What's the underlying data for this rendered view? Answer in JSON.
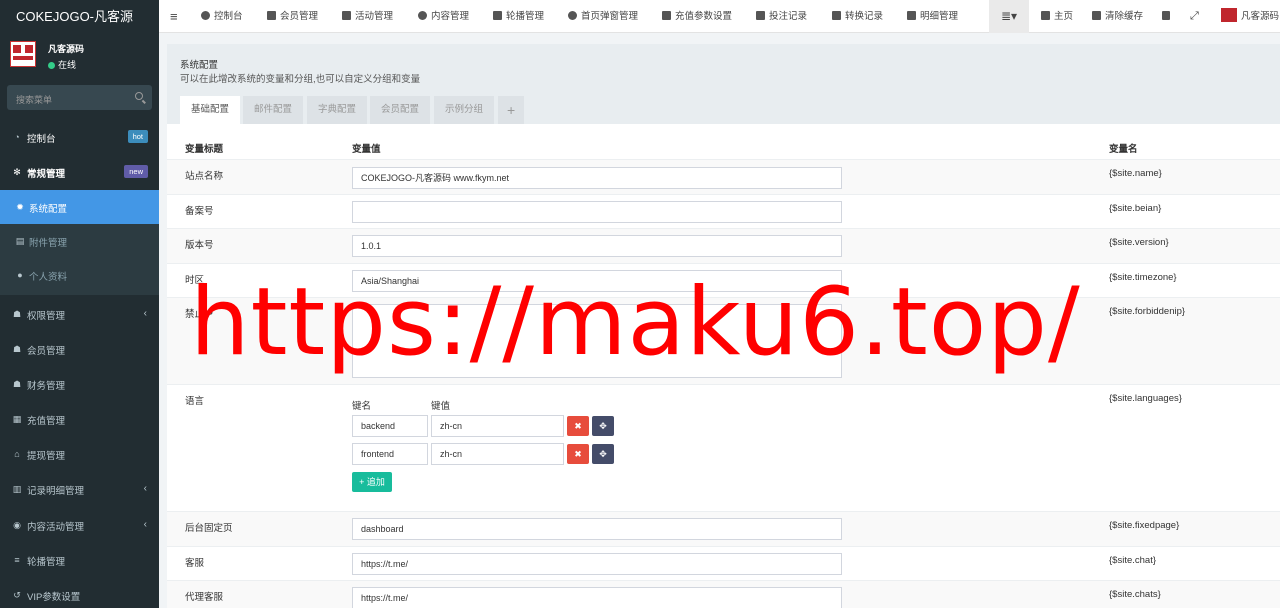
{
  "brand": {
    "title": "COKEJOGO-凡客源"
  },
  "user": {
    "name": "凡客源码",
    "status": "在线"
  },
  "search": {
    "placeholder": "搜索菜单"
  },
  "sidebar": {
    "items": [
      {
        "label": "控制台",
        "badge": "hot",
        "icon": "dashboard-icon"
      },
      {
        "label": "常规管理",
        "badge": "new",
        "icon": "cogs-icon"
      },
      {
        "label": "系统配置",
        "icon": "gear-icon"
      },
      {
        "label": "附件管理",
        "icon": "file-image-icon"
      },
      {
        "label": "个人资料",
        "icon": "user-icon"
      },
      {
        "label": "权限管理",
        "icon": "group-icon"
      },
      {
        "label": "会员管理",
        "icon": "users-icon"
      },
      {
        "label": "财务管理",
        "icon": "users-icon"
      },
      {
        "label": "充值管理",
        "icon": "th-large-icon"
      },
      {
        "label": "提现管理",
        "icon": "bank-icon"
      },
      {
        "label": "记录明细管理",
        "icon": "bar-chart-icon"
      },
      {
        "label": "内容活动管理",
        "icon": "chrome-icon"
      },
      {
        "label": "轮播管理",
        "icon": "list-icon"
      },
      {
        "label": "VIP参数设置",
        "icon": "history-icon"
      }
    ]
  },
  "topbar": {
    "tabs": [
      "控制台",
      "会员管理",
      "活动管理",
      "内容管理",
      "轮播管理",
      "首页弹窗管理",
      "充值参数设置",
      "投注记录",
      "转换记录",
      "明细管理"
    ],
    "home": "主页",
    "clear_cache": "清除缓存",
    "user": "凡客源码"
  },
  "panel": {
    "title": "系统配置",
    "description": "可以在此增改系统的变量和分组,也可以自定义分组和变量",
    "tabs": [
      "基础配置",
      "邮件配置",
      "字典配置",
      "会员配置",
      "示例分组"
    ],
    "add_tab": "+"
  },
  "table": {
    "headers": {
      "title": "变量标题",
      "value": "变量值",
      "name": "变量名"
    },
    "rows": [
      {
        "title": "站点名称",
        "value": "COKEJOGO-凡客源码 www.fkym.net",
        "name": "{$site.name}"
      },
      {
        "title": "备案号",
        "value": "",
        "name": "{$site.beian}"
      },
      {
        "title": "版本号",
        "value": "1.0.1",
        "name": "{$site.version}"
      },
      {
        "title": "时区",
        "value": "Asia/Shanghai",
        "name": "{$site.timezone}"
      },
      {
        "title": "禁止IP",
        "value": "",
        "name": "{$site.forbiddenip}"
      },
      {
        "title": "语言",
        "name": "{$site.languages}"
      },
      {
        "title": "后台固定页",
        "value": "dashboard",
        "name": "{$site.fixedpage}"
      },
      {
        "title": "客服",
        "value": "https://t.me/",
        "name": "{$site.chat}"
      },
      {
        "title": "代理客服",
        "value": "https://t.me/",
        "name": "{$site.chats}"
      }
    ],
    "languages": {
      "key_header": "键名",
      "value_header": "键值",
      "entries": [
        {
          "key": "backend",
          "value": "zh-cn"
        },
        {
          "key": "frontend",
          "value": "zh-cn"
        }
      ],
      "add_label": "追加"
    }
  },
  "watermark": "https://maku6.top/",
  "colors": {
    "sidebar": "#222d32",
    "active": "#4397e6",
    "add": "#18bc9c",
    "danger": "#e74c3c",
    "watermark": "#ff0000"
  }
}
